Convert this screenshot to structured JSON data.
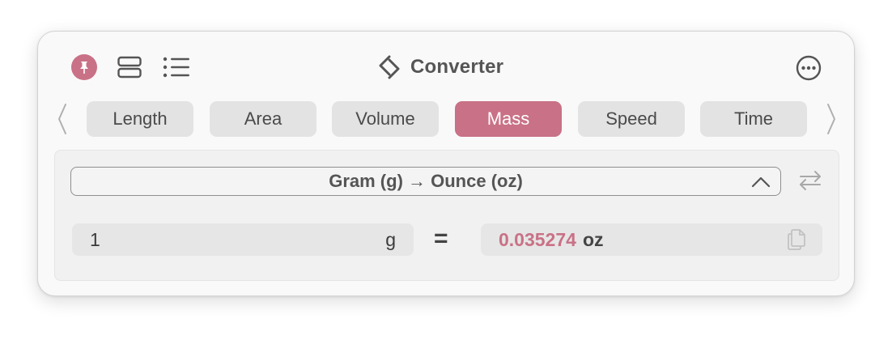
{
  "toolbar": {
    "title": "Converter",
    "icons": {
      "pin": "pin-icon",
      "layout": "layout-icon",
      "list": "list-icon",
      "logo": "converter-logo-icon",
      "more": "more-icon"
    }
  },
  "tabs": [
    {
      "label": "Length",
      "active": false
    },
    {
      "label": "Area",
      "active": false
    },
    {
      "label": "Volume",
      "active": false
    },
    {
      "label": "Mass",
      "active": true
    },
    {
      "label": "Speed",
      "active": false
    },
    {
      "label": "Time",
      "active": false
    }
  ],
  "conversion": {
    "selector_label": "Gram (g) → Ounce (oz)",
    "input_value": "1",
    "input_unit": "g",
    "equals": "=",
    "result_value": "0.035274",
    "result_unit": "oz"
  },
  "colors": {
    "accent": "#c97186",
    "tab_bg": "#e3e3e3",
    "window_bg": "#f9f9f9"
  }
}
